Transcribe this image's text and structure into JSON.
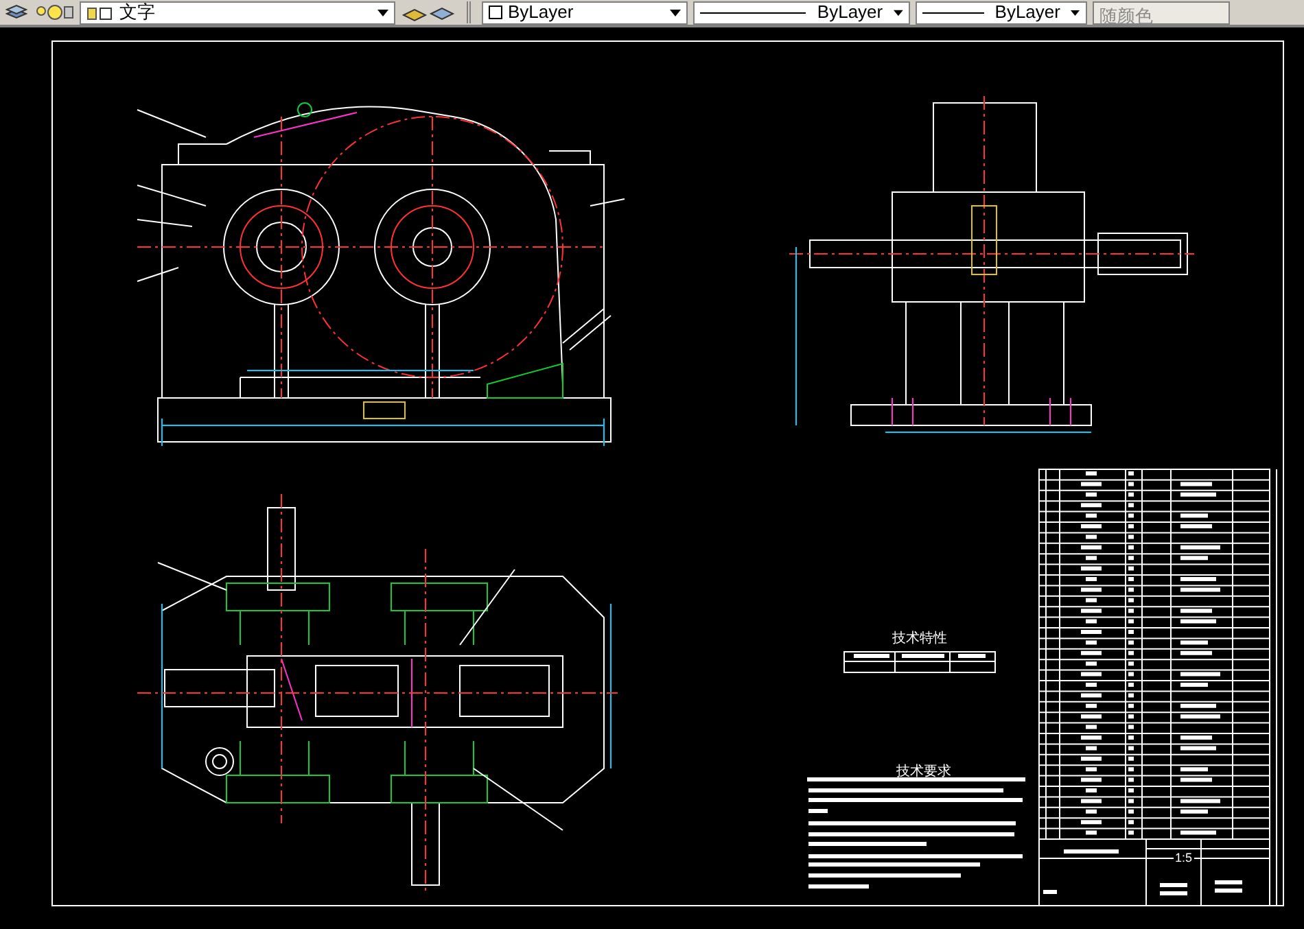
{
  "toolbar": {
    "layer": "文字",
    "color_setting": "ByLayer",
    "linetype": "ByLayer",
    "lineweight": "ByLayer",
    "plot_style": {
      "label": "随颜色",
      "disabled": true
    }
  },
  "drawing": {
    "tech_spec_title": "技术特性",
    "tech_req_title": "技术要求",
    "scale": "1:5"
  }
}
